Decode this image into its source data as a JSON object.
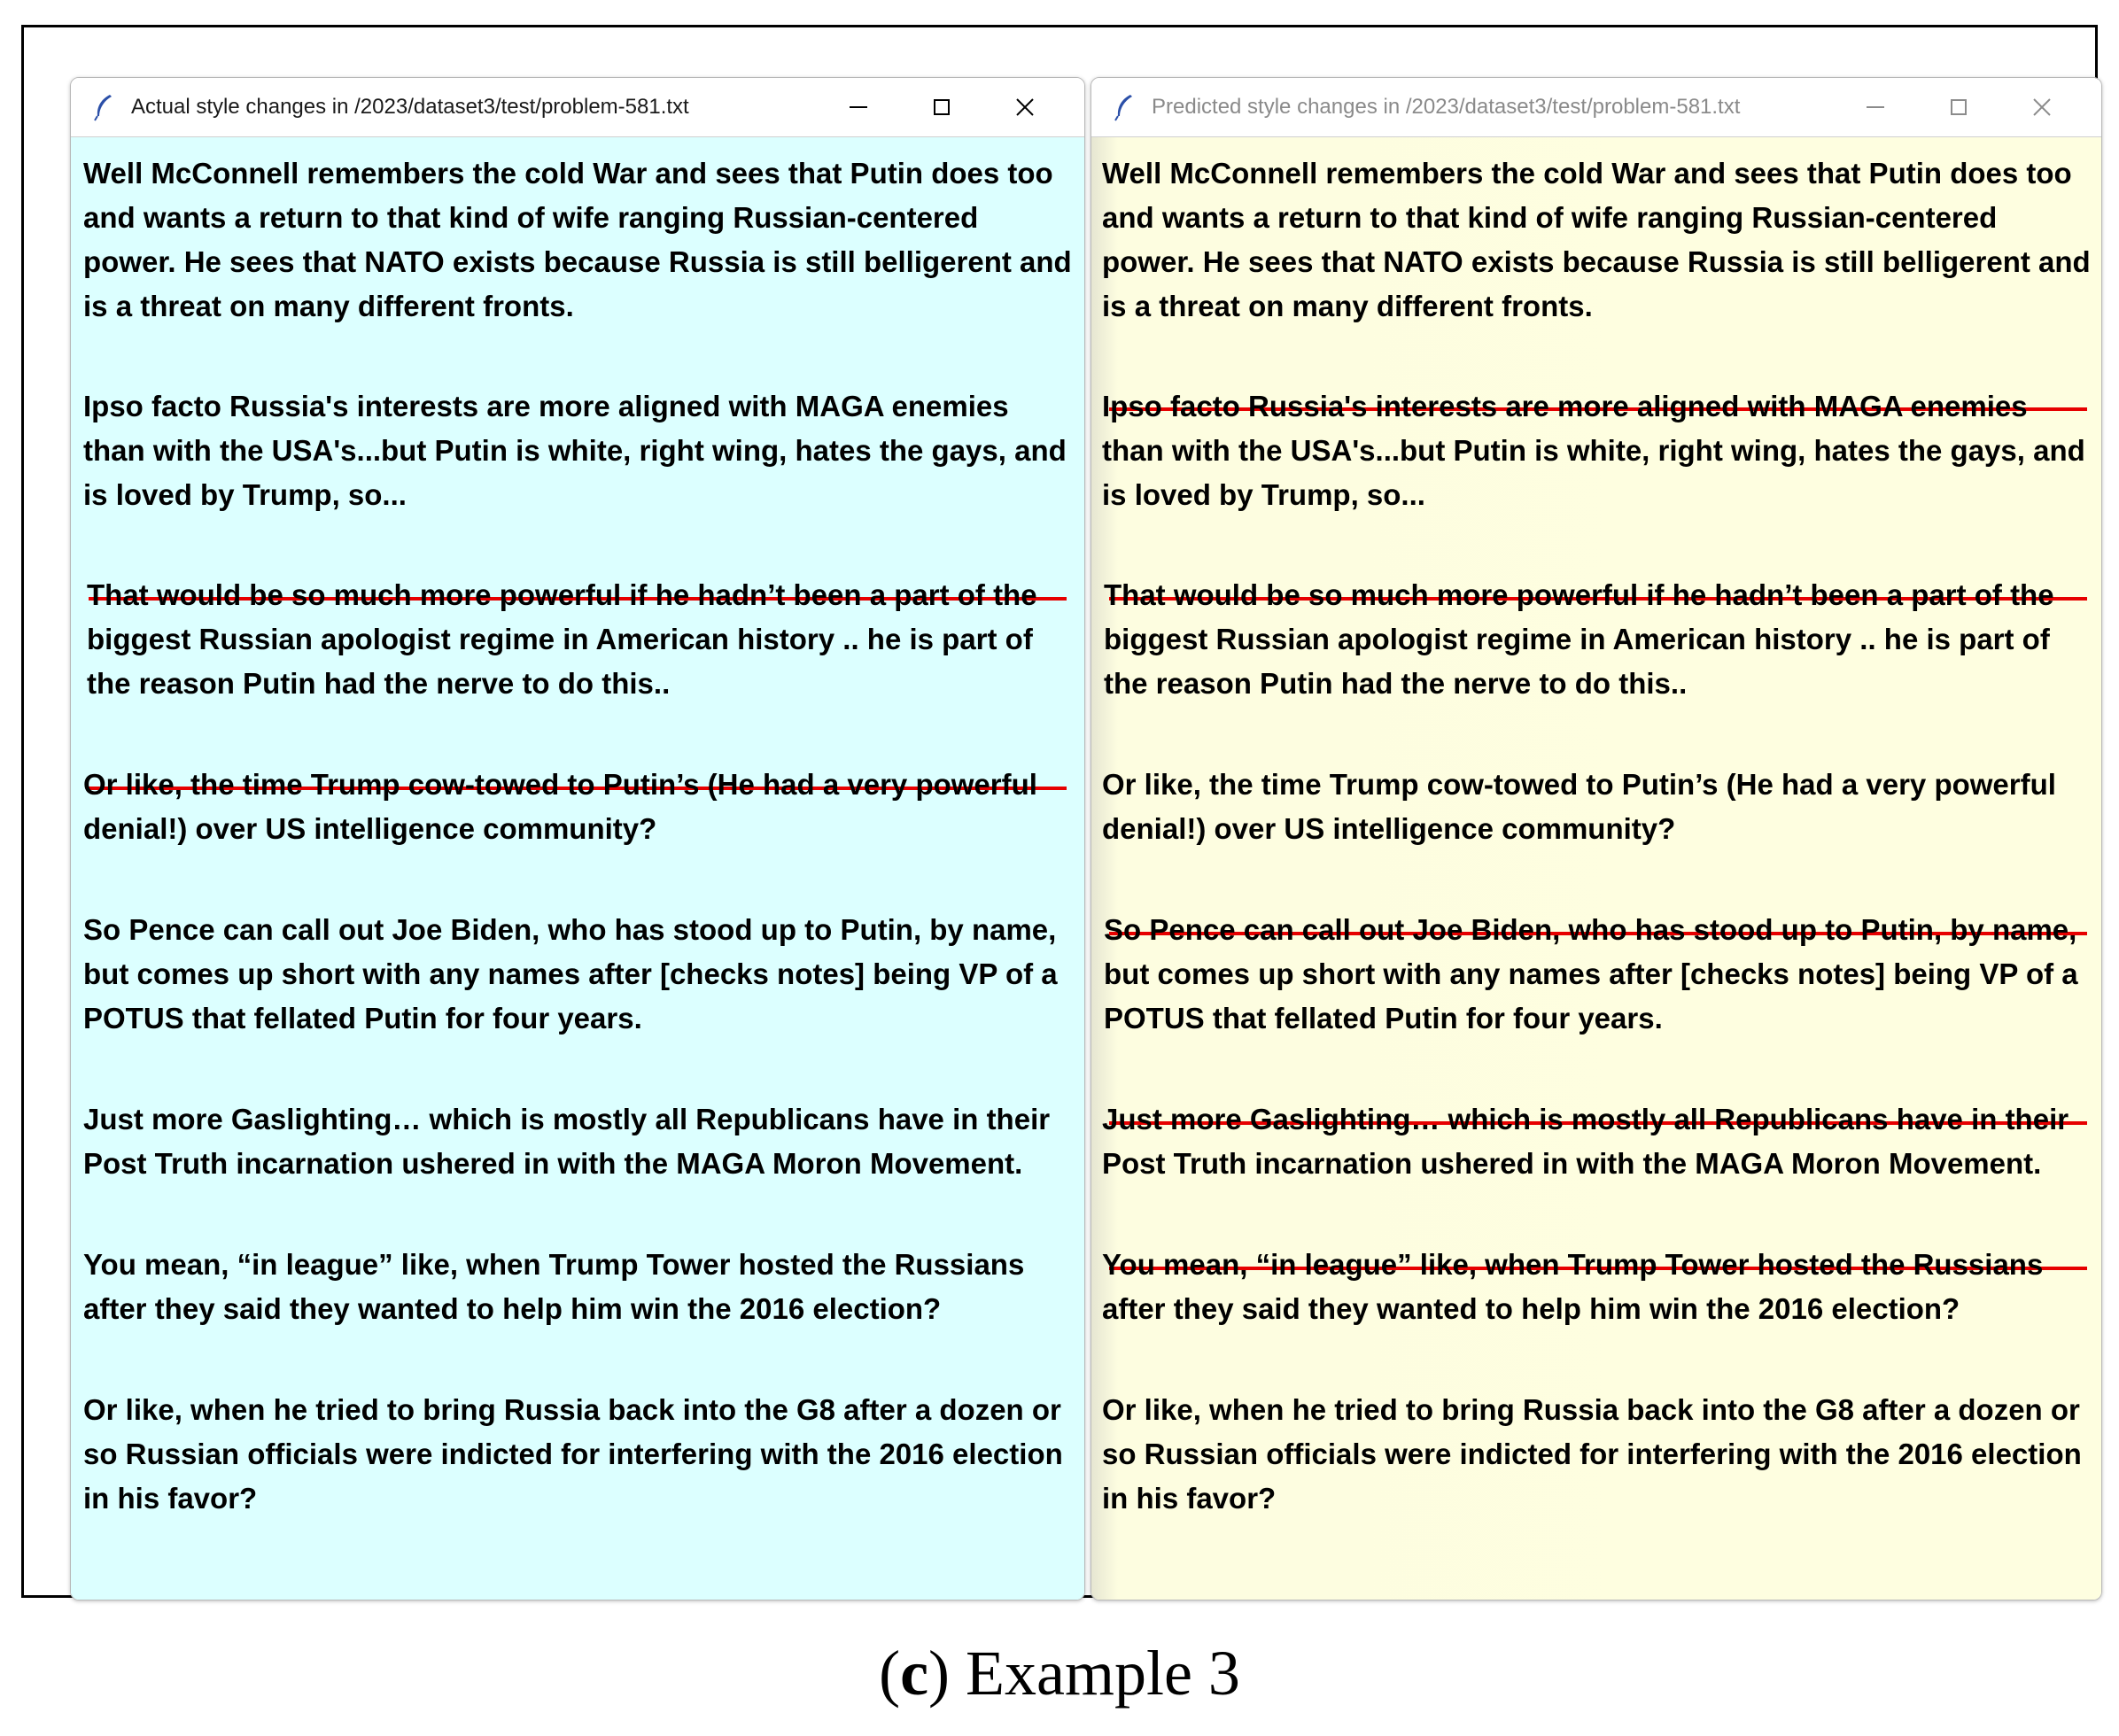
{
  "windows": {
    "left": {
      "title": "Actual style changes in /2023/dataset3/test/problem-581.txt"
    },
    "right": {
      "title": "Predicted style changes in /2023/dataset3/test/problem-581.txt"
    }
  },
  "paragraphs": [
    "Well McConnell remembers the cold War and sees that Putin does too and wants a return to that kind of wife ranging Russian-centered power. He sees that NATO exists because Russia is still belligerent and is a threat on many different fronts.",
    "Ipso facto Russia's interests are more aligned with MAGA enemies than with the USA's...but Putin is white, right wing, hates the gays, and is loved by Trump, so...",
    "That would be so much more powerful if he hadn’t been a part of the biggest Russian apologist regime in American history .. he is part of the reason Putin had the nerve to do this..",
    "Or like, the time Trump cow-towed to Putin’s (He had a very powerful denial!) over US intelligence community?",
    "So Pence can call out Joe Biden, who has stood up to Putin, by name, but comes up short with any names after [checks notes] being VP of a POTUS that fellated Putin for four years.",
    "Just more Gaslighting… which is mostly all Republicans have in their Post Truth incarnation ushered in with the MAGA Moron Movement.",
    "You mean, “in league” like, when Trump Tower hosted the Russians after they said they wanted to help him win the 2016 election?",
    "Or like, when he tried to bring Russia back into the G8 after a dozen or so Russian officials were indicted for interfering with the 2016 election in his favor?"
  ],
  "caption": {
    "label": "(c)",
    "letter": "c",
    "text": "Example 3"
  },
  "colors": {
    "left_background": "#dcffff",
    "right_background": "#fefee0",
    "separator": "#e60000"
  }
}
